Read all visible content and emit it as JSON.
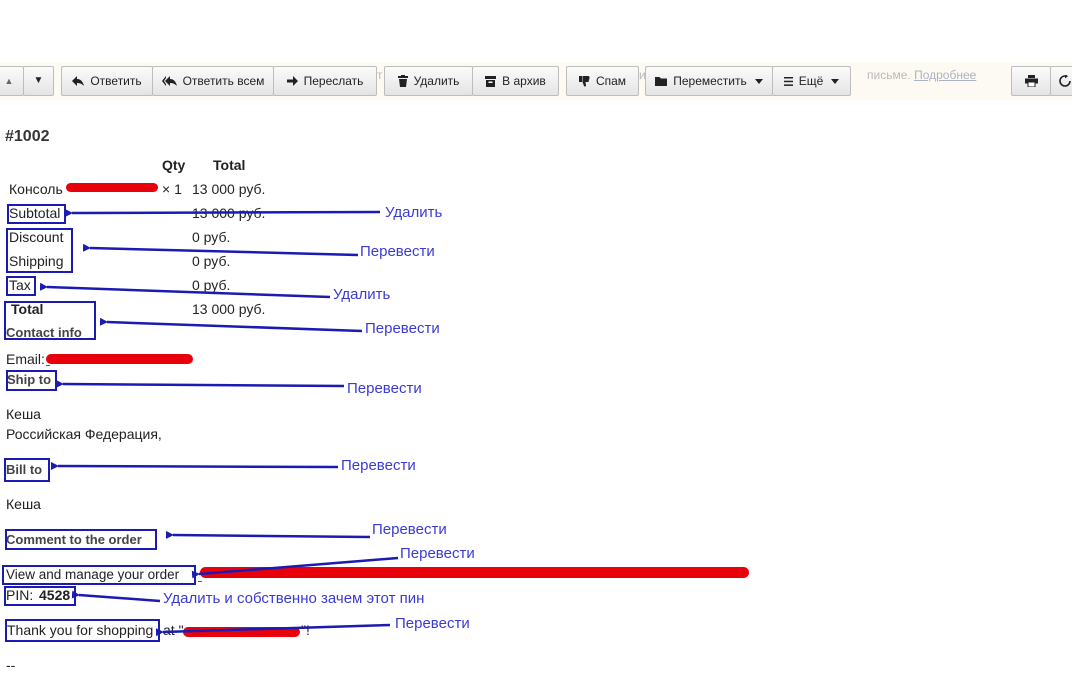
{
  "toolbar": {
    "nav_up": "▲",
    "nav_down": "▼",
    "reply": "Ответить",
    "reply_all": "Ответить всем",
    "forward": "Переслать",
    "delete": "Удалить",
    "archive": "В архив",
    "spam": "Спам",
    "move": "Переместить",
    "more": "Ещё",
    "notice_left": "т",
    "notice_mid": "и",
    "notice_right": "письме.",
    "notice_link": "Подробнее"
  },
  "order": {
    "number": "#1002",
    "col_qty": "Qty",
    "col_total": "Total",
    "item_name": "Консоль",
    "item_qty": "× 1",
    "item_price": "13 000 руб.",
    "subtotal_label": "Subtotal",
    "subtotal_value": "13 000 руб.",
    "discount_label": "Discount",
    "discount_value": "0 руб.",
    "shipping_label": "Shipping",
    "shipping_value": "0 руб.",
    "tax_label": "Tax",
    "tax_value": "0 руб.",
    "total_label": "Total",
    "total_value": "13 000 руб.",
    "contact_heading": "Contact info",
    "email_label": "Email:",
    "ship_heading": "Ship to",
    "ship_name": "Кеша",
    "ship_country": "Российская Федерация,",
    "bill_heading": "Bill to",
    "bill_name": "Кеша",
    "comment_heading": "Comment to the order",
    "manage_text": "View and manage your order",
    "pin_label": "PIN:",
    "pin_value": "4528",
    "thanks_text": "Thank you for shopping",
    "thanks_tail": "at \"",
    "thanks_end": "\"!",
    "signature": "--"
  },
  "annotations": {
    "subtotal": "Удалить",
    "discount_shipping": "Перевести",
    "tax": "Удалить",
    "total_contact": "Перевести",
    "ship_to": "Перевести",
    "bill_to": "Перевести",
    "comment": "Перевести",
    "manage": "Перевести",
    "pin": "Удалить и собственно зачем  этот пин",
    "thanks": "Перевести"
  },
  "colors": {
    "annotation_blue": "#1b1bb3",
    "annotation_text": "#3a3ad6",
    "redaction_red": "#e8000b"
  }
}
